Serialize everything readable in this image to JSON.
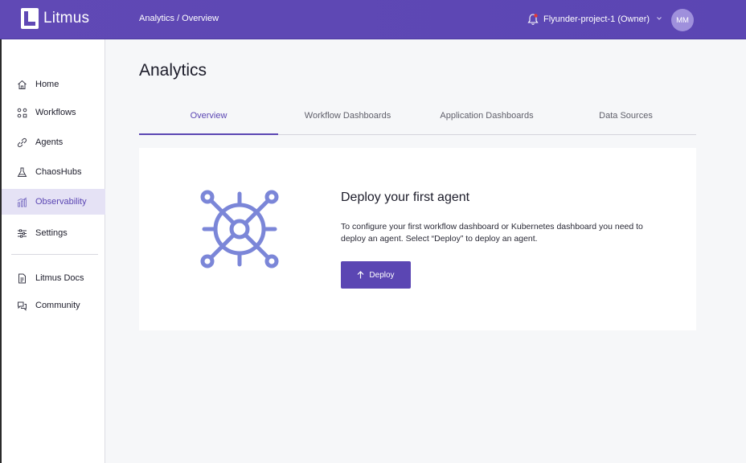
{
  "header": {
    "logo_text": "Litmus",
    "breadcrumb": "Analytics / Overview",
    "project": "Flyunder-project-1 (Owner)",
    "avatar_initials": "MM",
    "notification_dot_color": "#e53935"
  },
  "sidebar": {
    "items": [
      {
        "label": "Home",
        "icon": "home-icon"
      },
      {
        "label": "Workflows",
        "icon": "workflows-icon"
      },
      {
        "label": "Agents",
        "icon": "agents-icon"
      },
      {
        "label": "ChaosHubs",
        "icon": "chaoshubs-icon"
      },
      {
        "label": "Observability",
        "icon": "observability-icon",
        "active": true
      },
      {
        "label": "Settings",
        "icon": "settings-icon"
      },
      {
        "label": "Litmus Docs",
        "icon": "docs-icon"
      },
      {
        "label": "Community",
        "icon": "community-icon"
      }
    ]
  },
  "main": {
    "title": "Analytics",
    "tabs": [
      {
        "label": "Overview",
        "active": true
      },
      {
        "label": "Workflow Dashboards"
      },
      {
        "label": "Application Dashboards"
      },
      {
        "label": "Data Sources"
      }
    ],
    "card": {
      "title": "Deploy your first agent",
      "description": "To configure your first workflow dashboard or Kubernetes dashboard you need to deploy an agent. Select “Deploy” to deploy an agent.",
      "button_label": "Deploy"
    }
  },
  "colors": {
    "brand": "#5b46b3",
    "illustration": "#7b86d8"
  }
}
